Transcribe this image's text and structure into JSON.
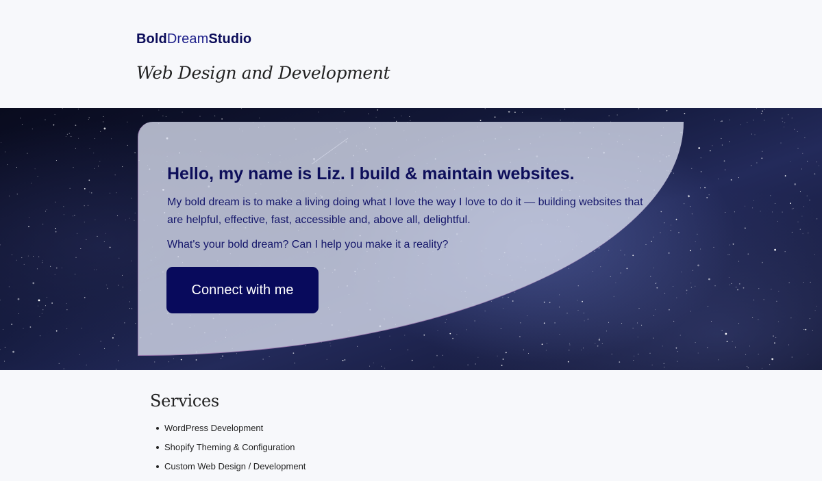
{
  "header": {
    "logo": {
      "part1": "Bold",
      "part2": "Dream",
      "part3": "Studio"
    },
    "tagline": "Web Design and Development"
  },
  "hero": {
    "title": "Hello, my name is Liz. I build & maintain websites.",
    "text": "My bold dream is to make a living doing what I love the way I love to do it — building websites that are helpful, effective, fast, accessible and, above all, delightful.",
    "question": "What's your bold dream? Can I help you make it a reality?",
    "cta_label": "Connect with me"
  },
  "services": {
    "title": "Services",
    "items": [
      "WordPress Development",
      "Shopify Theming & Configuration",
      "Custom Web Design / Development"
    ]
  },
  "colors": {
    "page_bg": "#f7f8fb",
    "brand_navy": "#0c0d5a",
    "cta_bg": "#080a5c",
    "card_bg": "#d2d7e8"
  }
}
